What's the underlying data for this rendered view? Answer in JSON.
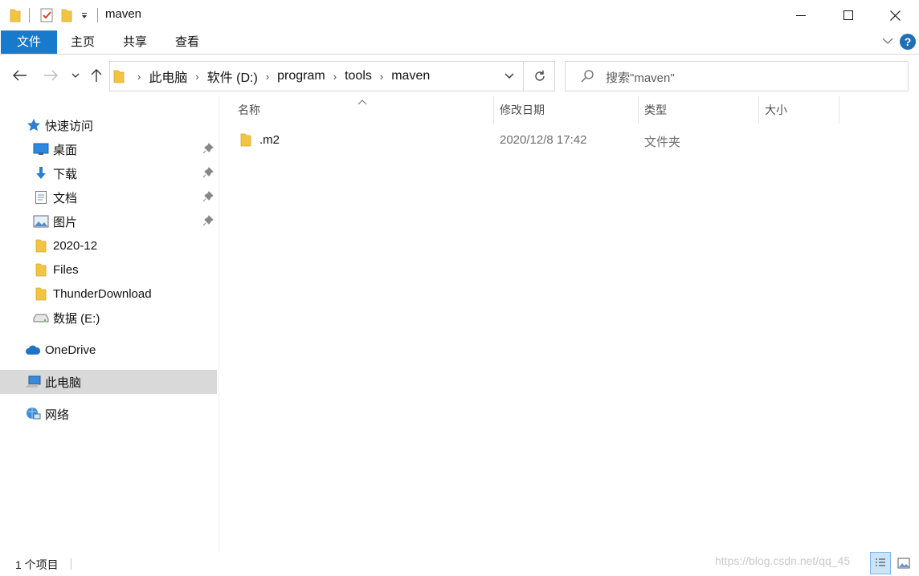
{
  "window": {
    "title": "maven",
    "controls": {
      "minimize": "minimize-icon",
      "maximize": "maximize-icon",
      "close": "close-icon"
    }
  },
  "ribbon": {
    "tabs": [
      {
        "label": "文件",
        "active": true
      },
      {
        "label": "主页"
      },
      {
        "label": "共享"
      },
      {
        "label": "查看"
      }
    ],
    "help_label": "?"
  },
  "address": {
    "crumbs": [
      "此电脑",
      "软件 (D:)",
      "program",
      "tools",
      "maven"
    ]
  },
  "search": {
    "placeholder": "搜索\"maven\""
  },
  "sidebar": {
    "quick_access": "快速访问",
    "items": [
      {
        "label": "桌面",
        "icon": "desktop-icon",
        "pinned": true
      },
      {
        "label": "下载",
        "icon": "download-icon",
        "pinned": true
      },
      {
        "label": "文档",
        "icon": "document-icon",
        "pinned": true
      },
      {
        "label": "图片",
        "icon": "pictures-icon",
        "pinned": true
      },
      {
        "label": "2020-12",
        "icon": "folder-icon"
      },
      {
        "label": "Files",
        "icon": "folder-icon"
      },
      {
        "label": "ThunderDownload",
        "icon": "folder-icon"
      },
      {
        "label": "数据 (E:)",
        "icon": "drive-icon"
      }
    ],
    "onedrive": "OneDrive",
    "this_pc": "此电脑",
    "network": "网络"
  },
  "columns": {
    "name": "名称",
    "modified": "修改日期",
    "type": "类型",
    "size": "大小"
  },
  "files": [
    {
      "name": ".m2",
      "modified": "2020/12/8 17:42",
      "type": "文件夹",
      "size": ""
    }
  ],
  "status": {
    "count": "1 个项目",
    "watermark": "https://blog.csdn.net/qq_45"
  },
  "colors": {
    "accent": "#1979ca",
    "folder": "#f2c443",
    "selected": "#d9d9d9"
  }
}
